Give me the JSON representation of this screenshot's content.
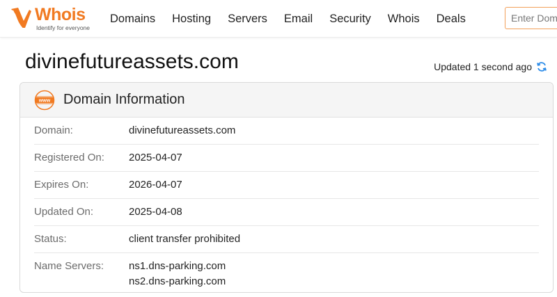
{
  "brand": {
    "name": "Whois",
    "tagline": "Identify for everyone",
    "color": "#f17a21"
  },
  "nav": [
    {
      "label": "Domains"
    },
    {
      "label": "Hosting"
    },
    {
      "label": "Servers"
    },
    {
      "label": "Email"
    },
    {
      "label": "Security"
    },
    {
      "label": "Whois"
    },
    {
      "label": "Deals"
    }
  ],
  "search": {
    "placeholder": "Enter Domain"
  },
  "page": {
    "domain": "divinefutureassets.com",
    "updated_text": "Updated 1 second ago",
    "refresh_icon": "refresh-icon"
  },
  "card": {
    "icon": "www-icon",
    "title": "Domain Information",
    "rows": [
      {
        "label": "Domain:",
        "value": "divinefutureassets.com"
      },
      {
        "label": "Registered On:",
        "value": "2025-04-07"
      },
      {
        "label": "Expires On:",
        "value": "2026-04-07"
      },
      {
        "label": "Updated On:",
        "value": "2025-04-08"
      },
      {
        "label": "Status:",
        "value": "client transfer prohibited"
      }
    ],
    "name_servers": {
      "label": "Name Servers:",
      "values": [
        "ns1.dns-parking.com",
        "ns2.dns-parking.com"
      ]
    }
  }
}
